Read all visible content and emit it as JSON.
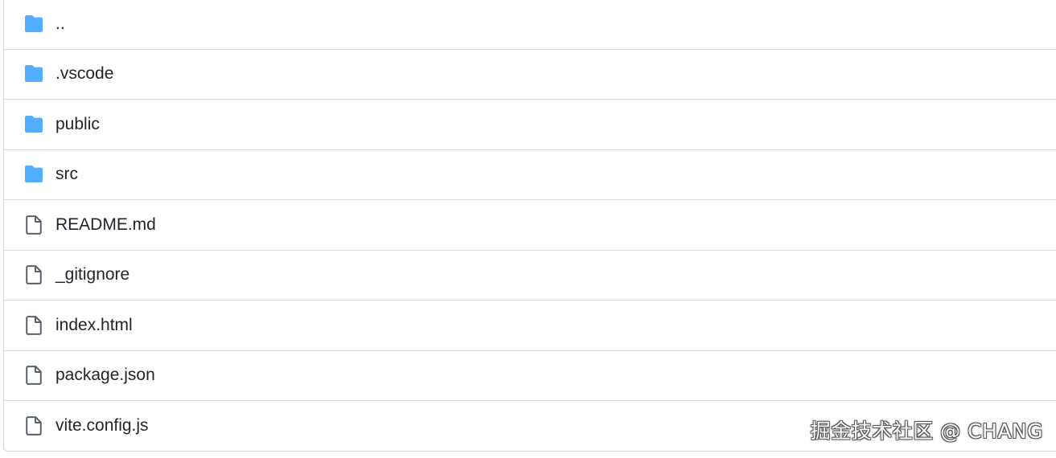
{
  "colors": {
    "folder": "#54aeff",
    "file_outline": "#57606a",
    "border": "#d8dee4",
    "text": "#1f2328"
  },
  "file_list": {
    "items": [
      {
        "type": "folder",
        "icon": "folder-icon",
        "name": ".."
      },
      {
        "type": "folder",
        "icon": "folder-icon",
        "name": ".vscode"
      },
      {
        "type": "folder",
        "icon": "folder-icon",
        "name": "public"
      },
      {
        "type": "folder",
        "icon": "folder-icon",
        "name": "src"
      },
      {
        "type": "file",
        "icon": "file-icon",
        "name": "README.md"
      },
      {
        "type": "file",
        "icon": "file-icon",
        "name": "_gitignore"
      },
      {
        "type": "file",
        "icon": "file-icon",
        "name": "index.html"
      },
      {
        "type": "file",
        "icon": "file-icon",
        "name": "package.json"
      },
      {
        "type": "file",
        "icon": "file-icon",
        "name": "vite.config.js"
      }
    ]
  },
  "watermark": {
    "text": "掘金技术社区 @ CHANG"
  }
}
